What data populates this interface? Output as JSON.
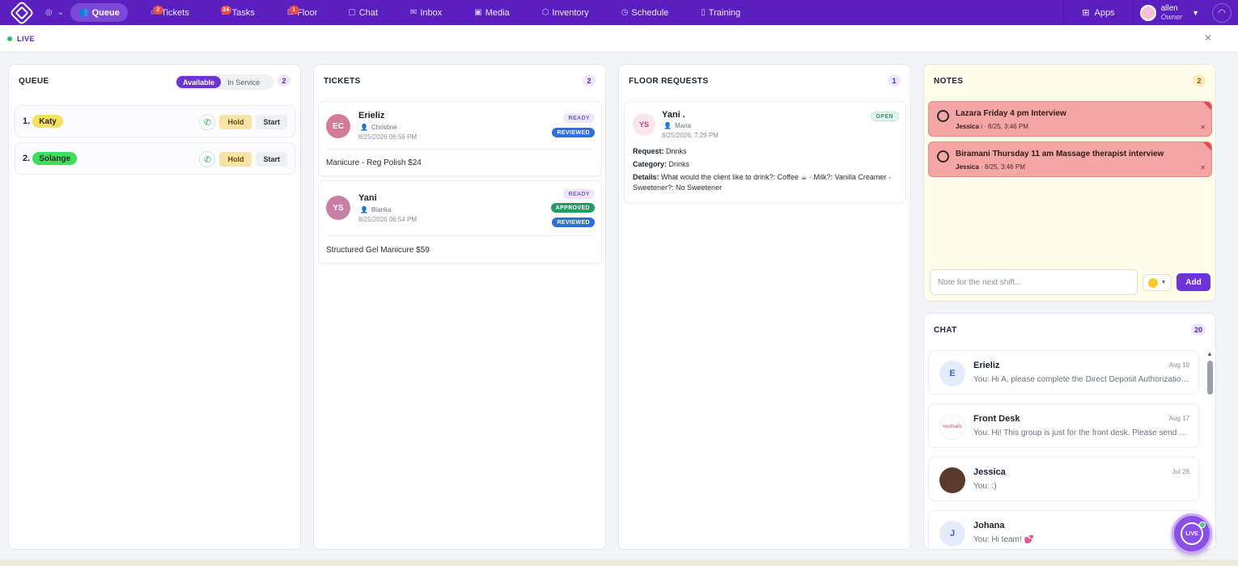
{
  "nav": {
    "items": [
      {
        "label": "Queue",
        "icon": "people-icon",
        "badge": ""
      },
      {
        "label": "Tickets",
        "icon": "ticket-icon",
        "badge": "2"
      },
      {
        "label": "Tasks",
        "icon": "tasks-icon",
        "badge": "24"
      },
      {
        "label": "Floor",
        "icon": "floor-icon",
        "badge": "1"
      },
      {
        "label": "Chat",
        "icon": "chat-icon",
        "badge": ""
      },
      {
        "label": "Inbox",
        "icon": "inbox-icon",
        "badge": ""
      },
      {
        "label": "Media",
        "icon": "media-icon",
        "badge": ""
      },
      {
        "label": "Inventory",
        "icon": "inventory-icon",
        "badge": ""
      },
      {
        "label": "Schedule",
        "icon": "clock-icon",
        "badge": ""
      },
      {
        "label": "Training",
        "icon": "book-icon",
        "badge": ""
      }
    ],
    "apps_label": "Apps",
    "user_name": "allen",
    "user_role": "Owner"
  },
  "livebar": {
    "label": "LIVE"
  },
  "queue": {
    "title": "QUEUE",
    "toggle_available": "Available",
    "toggle_in_service": "In Service",
    "count": "2",
    "rows": [
      {
        "num": "1.",
        "name": "Katy",
        "color": "#f7e05a",
        "hold": "Hold",
        "start": "Start"
      },
      {
        "num": "2.",
        "name": "Solange",
        "color": "#3ee05a",
        "hold": "Hold",
        "start": "Start"
      }
    ]
  },
  "tickets": {
    "title": "TICKETS",
    "count": "2",
    "items": [
      {
        "initials": "EC",
        "name": "Erieliz",
        "staff": "Christine",
        "date": "8/25/2026 06:56 PM",
        "service": "Manicure - Reg Polish $24",
        "badges": [
          "READY",
          "REVIEWED"
        ],
        "avatar_color": "#d67a9a"
      },
      {
        "initials": "YS",
        "name": "Yani",
        "staff": "Blanka",
        "date": "8/25/2026 06:54 PM",
        "service": "Structured Gel Manicure $59",
        "badges": [
          "READY",
          "APPROVED",
          "REVIEWED"
        ],
        "avatar_color": "#c77fa6"
      }
    ]
  },
  "floor": {
    "title": "FLOOR REQUESTS",
    "count": "1",
    "request": {
      "initials": "YS",
      "name": "Yani .",
      "staff": "Maria",
      "date": "8/25/2026, 7:29 PM",
      "status": "OPEN",
      "request_label": "Request:",
      "request_value": "Drinks",
      "category_label": "Category:",
      "category_value": "Drinks",
      "details_label": "Details:",
      "details_value": "What would the client like to drink?: Coffee ☕ · Milk?: Vanilla Creamer · Sweetener?: No Sweetener"
    }
  },
  "notes": {
    "title": "NOTES",
    "count": "2",
    "items": [
      {
        "title": "Lazara Friday 4 pm Interview",
        "author": "Jessica",
        "meta": "i · 8/25, 3:46 PM"
      },
      {
        "title": "Biramani Thursday 11 am Massage therapist interview",
        "author": "Jessica",
        "meta": "· 8/25, 3:46 PM"
      }
    ],
    "input_placeholder": "Note for the next shift...",
    "add_label": "Add",
    "selected_color": "#f6cd2c"
  },
  "chat": {
    "title": "CHAT",
    "count": "20",
    "items": [
      {
        "avatar": "E",
        "name": "Erieliz",
        "time": "Aug 19",
        "msg": "You: Hi A, please complete the Direct Deposit Authorization form",
        "avatar_bg": "#e3ecfb",
        "avatar_fg": "#3a66c9"
      },
      {
        "avatar": "nestnails",
        "name": "Front Desk",
        "time": "Aug 17",
        "msg": "You: Hi! This group is just for the front desk. Please send updates here",
        "avatar_bg": "#ffffff",
        "avatar_fg": "#d2417a"
      },
      {
        "avatar": "",
        "name": "Jessica",
        "time": "Jul 28",
        "msg": "You: :)",
        "avatar_bg": "#5b3a2e",
        "avatar_fg": "#ffffff"
      },
      {
        "avatar": "J",
        "name": "Johana",
        "time": "",
        "msg": "You: Hi team! 💕",
        "avatar_bg": "#e3ecfb",
        "avatar_fg": "#3a66c9"
      }
    ]
  },
  "fab": {
    "label": "LIVE"
  }
}
